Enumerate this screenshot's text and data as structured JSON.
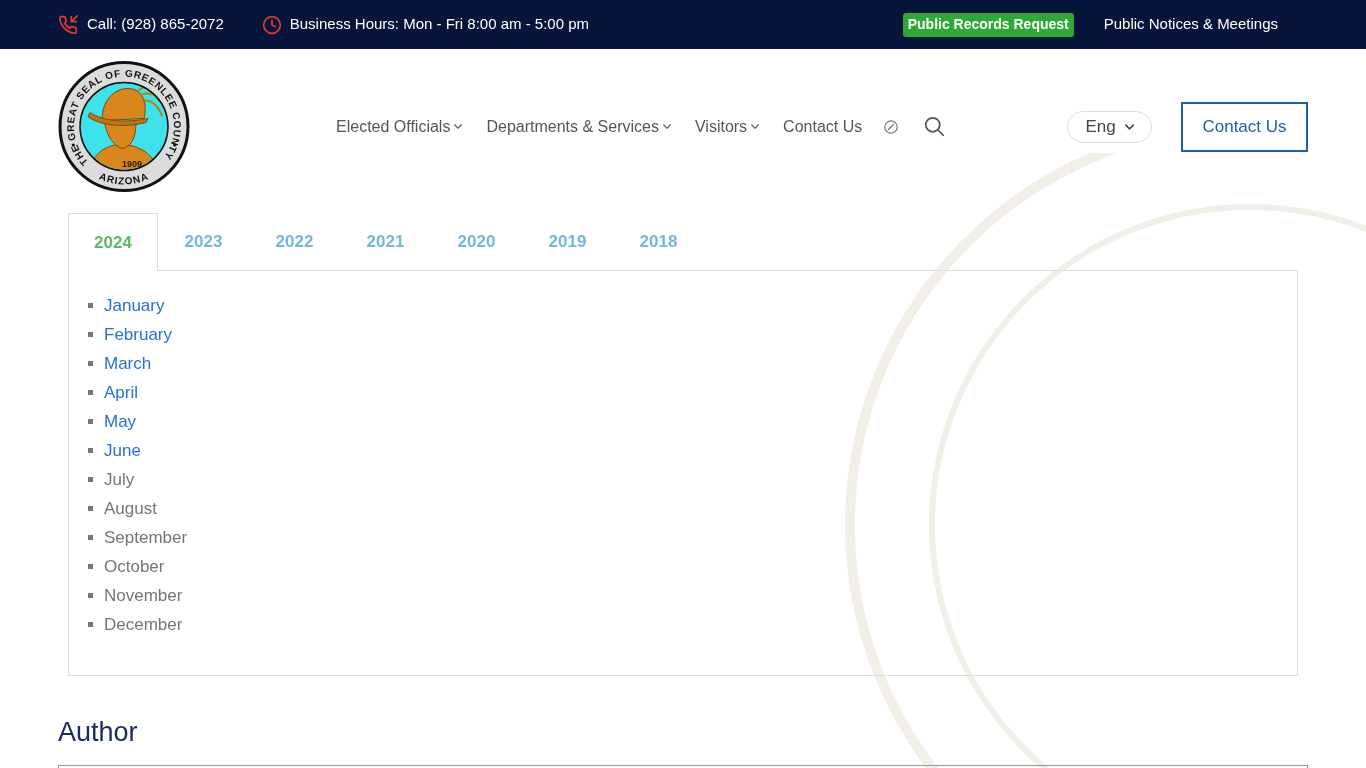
{
  "top_bar": {
    "phone": "Call: (928) 865-2072",
    "hours": "Business Hours: Mon - Fri 8:00 am - 5:00 pm",
    "records_button": "Public Records Request",
    "notices_link": "Public Notices & Meetings"
  },
  "header": {
    "logo": {
      "ring_text": "THE GREAT SEAL OF GREENLEE COUNTY",
      "bottom_text": "ARIZONA",
      "year": "1909"
    },
    "nav": [
      {
        "label": "Elected Officials",
        "dropdown": true
      },
      {
        "label": "Departments & Services",
        "dropdown": true
      },
      {
        "label": "Visitors",
        "dropdown": true
      },
      {
        "label": "Contact Us",
        "dropdown": false
      }
    ],
    "language": "Eng",
    "contact_button": "Contact Us"
  },
  "tabs": [
    {
      "label": "2024",
      "selected": true
    },
    {
      "label": "2023",
      "selected": false
    },
    {
      "label": "2022",
      "selected": false
    },
    {
      "label": "2021",
      "selected": false
    },
    {
      "label": "2020",
      "selected": false
    },
    {
      "label": "2019",
      "selected": false
    },
    {
      "label": "2018",
      "selected": false
    }
  ],
  "months": [
    {
      "label": "January",
      "linked": true
    },
    {
      "label": "February",
      "linked": true
    },
    {
      "label": "March",
      "linked": true
    },
    {
      "label": "April",
      "linked": true
    },
    {
      "label": "May",
      "linked": true
    },
    {
      "label": "June",
      "linked": true
    },
    {
      "label": "July",
      "linked": false
    },
    {
      "label": "August",
      "linked": false
    },
    {
      "label": "September",
      "linked": false
    },
    {
      "label": "October",
      "linked": false
    },
    {
      "label": "November",
      "linked": false
    },
    {
      "label": "December",
      "linked": false
    }
  ],
  "author_heading": "Author"
}
